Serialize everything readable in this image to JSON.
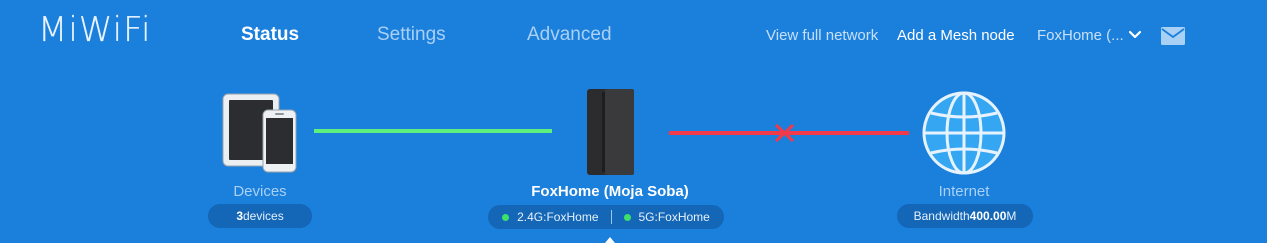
{
  "header": {
    "logo": "MiWiFi",
    "tabs": [
      {
        "label": "Status",
        "active": true
      },
      {
        "label": "Settings",
        "active": false
      },
      {
        "label": "Advanced",
        "active": false
      }
    ],
    "view_full_network": "View full network",
    "add_mesh_node": "Add a Mesh node",
    "router_select": "FoxHome (...",
    "icons": {
      "dropdown": "chevron-down-icon",
      "messages": "mail-icon"
    }
  },
  "topology": {
    "devices": {
      "label": "Devices",
      "count": "3",
      "count_suffix": " devices"
    },
    "router": {
      "name": "FoxHome (Moja Soba)",
      "band_24": "2.4G:FoxHome",
      "band_5": "5G:FoxHome"
    },
    "internet": {
      "label": "Internet",
      "bandwidth_prefix": "Bandwidth",
      "bandwidth_value": "400.00",
      "bandwidth_unit": "M"
    },
    "colors": {
      "background": "#1b7fdc",
      "devices_link": "#5ef07c",
      "internet_link": "#f23a4a",
      "status_dot": "#3ee06a",
      "pill": "#1466b6"
    },
    "internet_status": "disconnected"
  }
}
